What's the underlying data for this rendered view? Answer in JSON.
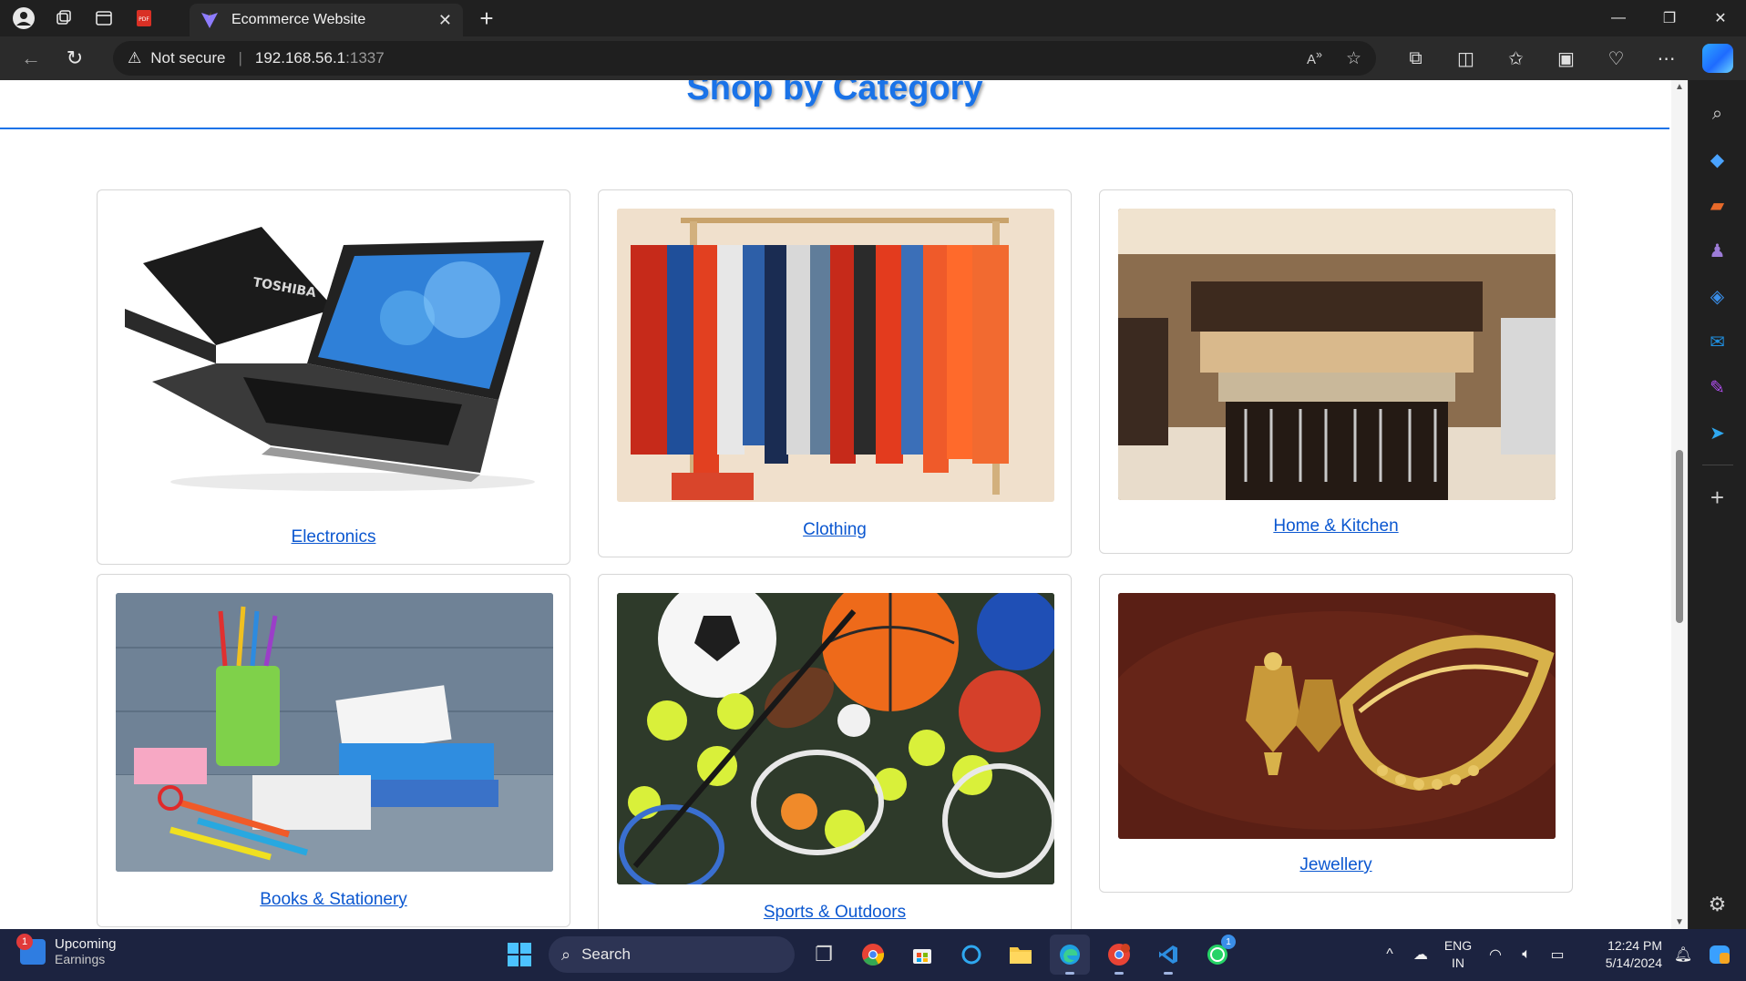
{
  "browser": {
    "tab_title": "Ecommerce Website",
    "security_label": "Not secure",
    "url_host": "192.168.56.1",
    "url_port": ":1337"
  },
  "page": {
    "section_title": "Shop by Category",
    "categories": [
      {
        "label": "Electronics"
      },
      {
        "label": "Clothing"
      },
      {
        "label": "Home & Kitchen"
      },
      {
        "label": "Books & Stationery"
      },
      {
        "label": "Sports & Outdoors"
      },
      {
        "label": "Jewellery"
      }
    ]
  },
  "taskbar": {
    "weather_title": "Upcoming",
    "weather_subtitle": "Earnings",
    "weather_badge": "1",
    "search_label": "Search",
    "lang_line1": "ENG",
    "lang_line2": "IN",
    "time": "12:24 PM",
    "date": "5/14/2024",
    "whatsapp_badge": "1"
  },
  "colors": {
    "accent": "#1a73e8",
    "link": "#0b57d0",
    "titlebar": "#202020",
    "taskbar": "#1c2340"
  }
}
